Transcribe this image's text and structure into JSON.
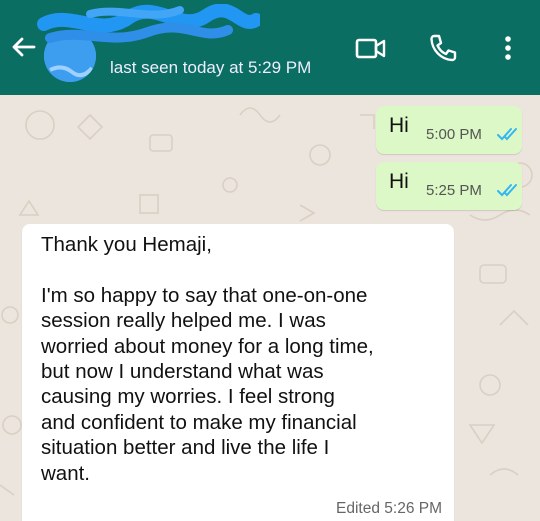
{
  "header": {
    "contact_name_obscured": "",
    "status": "last seen today at 5:29 PM",
    "back_icon": "arrow-left-icon",
    "video_icon": "video-call-icon",
    "call_icon": "phone-icon",
    "menu_icon": "more-vertical-icon"
  },
  "colors": {
    "header_bg": "#0b6e63",
    "chat_bg": "#ece5dd",
    "outgoing_bubble": "#dcf8c6",
    "incoming_bubble": "#ffffff",
    "read_ticks": "#34b7f1",
    "scribble": "#2196f3"
  },
  "messages": [
    {
      "direction": "outgoing",
      "text": "Hi",
      "time": "5:00 PM",
      "status_icon": "double-check-read-icon"
    },
    {
      "direction": "outgoing",
      "text": "Hi",
      "time": "5:25 PM",
      "status_icon": "double-check-read-icon"
    },
    {
      "direction": "incoming",
      "text": "Thank you Hemaji,\n\nI'm so happy to say that one-on-one\nsession really helped me. I was\nworried about money for a long time,\nbut now I understand what was\ncausing my worries. I feel strong\nand confident to make my financial\nsituation better and live the life I\nwant.",
      "time": "Edited 5:26 PM"
    }
  ]
}
